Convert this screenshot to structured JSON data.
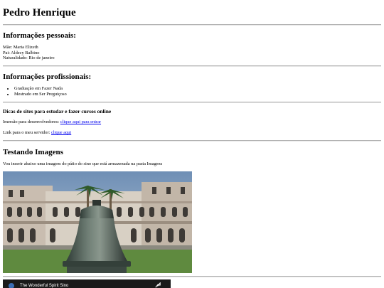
{
  "header": {
    "name": "Pedro Henrique"
  },
  "personal": {
    "heading": "Informações pessoais:",
    "lines": [
      "Mãe: Maria Elizeth",
      "Pai: Aldecy Balbino",
      "Naturalidade: Rio de janeiro"
    ]
  },
  "professional": {
    "heading": "Informações profissionais:",
    "items": [
      "Graduação em Fazer Nada",
      "Mestrado em Ser Preguiçoso"
    ]
  },
  "tips": {
    "heading": "Dicas de sites para estudar e fazer cursos online",
    "line1_prefix": "Imersão para desenvolvedores: ",
    "line1_link": "clique aqui para entrar",
    "line2_prefix": "Link para o meu servidor: ",
    "line2_link": "clique aqui"
  },
  "images": {
    "heading": "Testando Imagens",
    "description": "Vou inserir abaixo uma imagem do pátio do sino que está armazenada na pasta Imagens"
  },
  "video": {
    "title": "The Wonderful Spirit Sino"
  },
  "icons": [
    "bell-photo",
    "video-channel-icon",
    "share-icon"
  ]
}
